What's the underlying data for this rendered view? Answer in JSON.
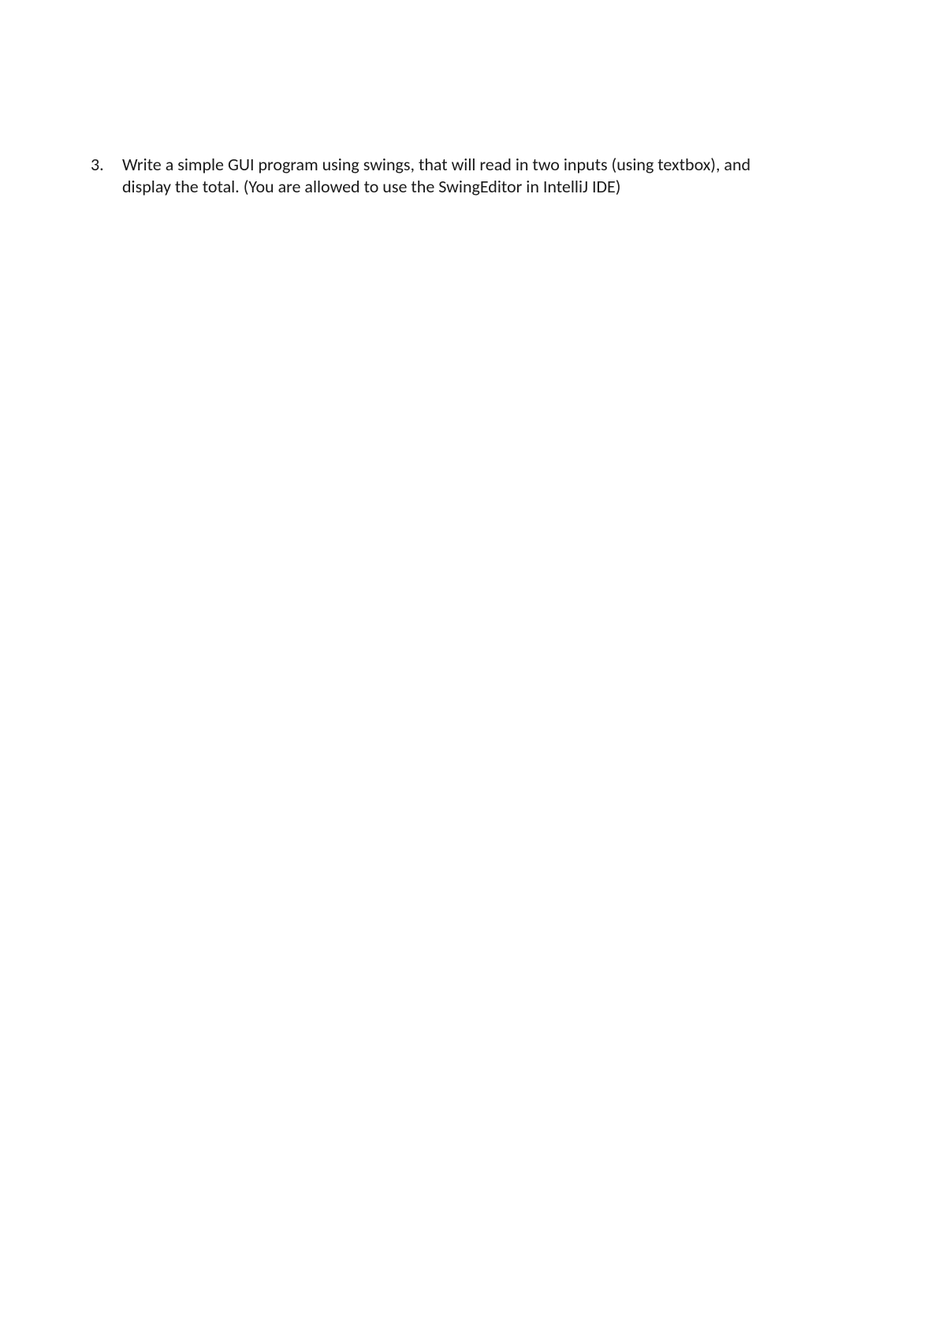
{
  "item": {
    "marker": "3.",
    "text": "Write a simple GUI program using swings, that will read in two inputs (using textbox), and display the total. (You are allowed to use the SwingEditor in IntelliJ IDE)"
  }
}
